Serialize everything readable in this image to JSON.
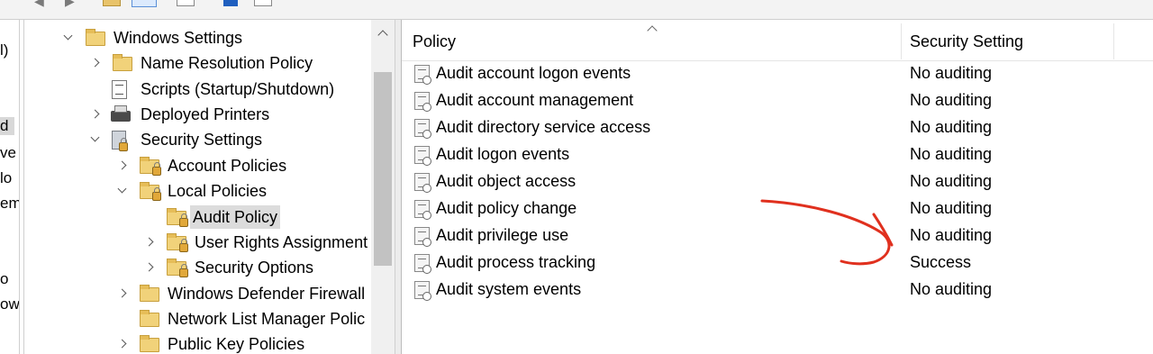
{
  "toolbar": {
    "icons": [
      "back-arrow-icon",
      "forward-arrow-icon",
      "folder-icon",
      "show-hide-pane-icon",
      "properties-icon",
      "help-icon",
      "export-icon"
    ]
  },
  "left_strip": {
    "fragments": [
      "l)",
      "d",
      "ve",
      "lo",
      "em",
      "o",
      "ow"
    ]
  },
  "tree": {
    "nodes": [
      {
        "label": "Windows Settings",
        "icon": "folder-icon",
        "expanded": true
      },
      {
        "label": "Name Resolution Policy",
        "icon": "folder-icon"
      },
      {
        "label": "Scripts (Startup/Shutdown)",
        "icon": "script-icon"
      },
      {
        "label": "Deployed Printers",
        "icon": "printer-icon"
      },
      {
        "label": "Security Settings",
        "icon": "security-settings-icon",
        "expanded": true
      },
      {
        "label": "Account Policies",
        "icon": "locked-folder-icon"
      },
      {
        "label": "Local Policies",
        "icon": "locked-folder-icon",
        "expanded": true
      },
      {
        "label": "Audit Policy",
        "icon": "locked-folder-icon",
        "selected": true
      },
      {
        "label": "User Rights Assignment",
        "icon": "locked-folder-icon"
      },
      {
        "label": "Security Options",
        "icon": "locked-folder-icon"
      },
      {
        "label": "Windows Defender Firewall",
        "icon": "folder-icon"
      },
      {
        "label": "Network List Manager Polic",
        "icon": "folder-icon"
      },
      {
        "label": "Public Key Policies",
        "icon": "folder-icon"
      }
    ]
  },
  "list": {
    "columns": [
      "Policy",
      "Security Setting"
    ],
    "rows": [
      {
        "policy": "Audit account logon events",
        "setting": "No auditing"
      },
      {
        "policy": "Audit account management",
        "setting": "No auditing"
      },
      {
        "policy": "Audit directory service access",
        "setting": "No auditing"
      },
      {
        "policy": "Audit logon events",
        "setting": "No auditing"
      },
      {
        "policy": "Audit object access",
        "setting": "No auditing"
      },
      {
        "policy": "Audit policy change",
        "setting": "No auditing"
      },
      {
        "policy": "Audit privilege use",
        "setting": "No auditing"
      },
      {
        "policy": "Audit process tracking",
        "setting": "Success"
      },
      {
        "policy": "Audit system events",
        "setting": "No auditing"
      }
    ]
  },
  "annotation": {
    "color": "#e0301e",
    "shape": "hand-drawn-arrow"
  },
  "colors": {
    "selection": "#dcdcdc",
    "folder": "#f1d27a"
  }
}
